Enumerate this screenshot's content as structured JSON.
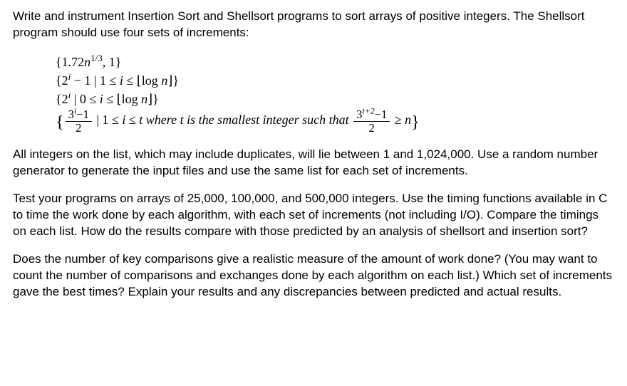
{
  "para1": "Write and instrument Insertion Sort and Shellsort programs to sort arrays of positive integers. The Shellsort program should use four sets of increments:",
  "formula": {
    "line1_open": "{1.72",
    "line1_rest": ", 1}",
    "line2_a": "{2",
    "line2_b": " − 1 | 1 ≤ ",
    "line2_c": " ≤  ⌊log ",
    "line2_d": "⌋}",
    "line3_a": "{2",
    "line3_b": " | 0 ≤ ",
    "line3_c": " ≤  ⌊log ",
    "line3_d": "⌋}",
    "line4_mid": " | 1 ≤ ",
    "line4_mid2": " ≤  ",
    "line4_txt": " where t is the smallest integer such that ",
    "line4_end": " ≥ ",
    "frac1_num_a": "3",
    "frac1_num_b": "−1",
    "frac2_num_a": "3",
    "frac2_num_b": "−1",
    "frac_den": "2",
    "exp_i": "i",
    "exp_t2": "t+2",
    "exp_13": "1/3",
    "var_n": "n",
    "var_i": "i",
    "var_t": "t",
    "brace_open": "{",
    "brace_close": "}"
  },
  "para2": "All integers on the list, which may include duplicates, will lie between 1 and 1,024,000.  Use a random number generator to generate the input files and use the same list for each set of increments.",
  "para3": "Test your programs on arrays of 25,000, 100,000, and 500,000 integers.  Use the timing functions available in C to time the work done by each algorithm, with each set of increments (not including I/O).  Compare the timings on each list.  How do the results compare with those predicted by an analysis of shellsort and insertion sort?",
  "para4": "Does the number of key comparisons give a realistic measure of the amount of work done?  (You may want to count the number of comparisons and exchanges done by each algorithm on each list.)  Which set of increments gave the best times?  Explain your results and any discrepancies between predicted and actual results."
}
